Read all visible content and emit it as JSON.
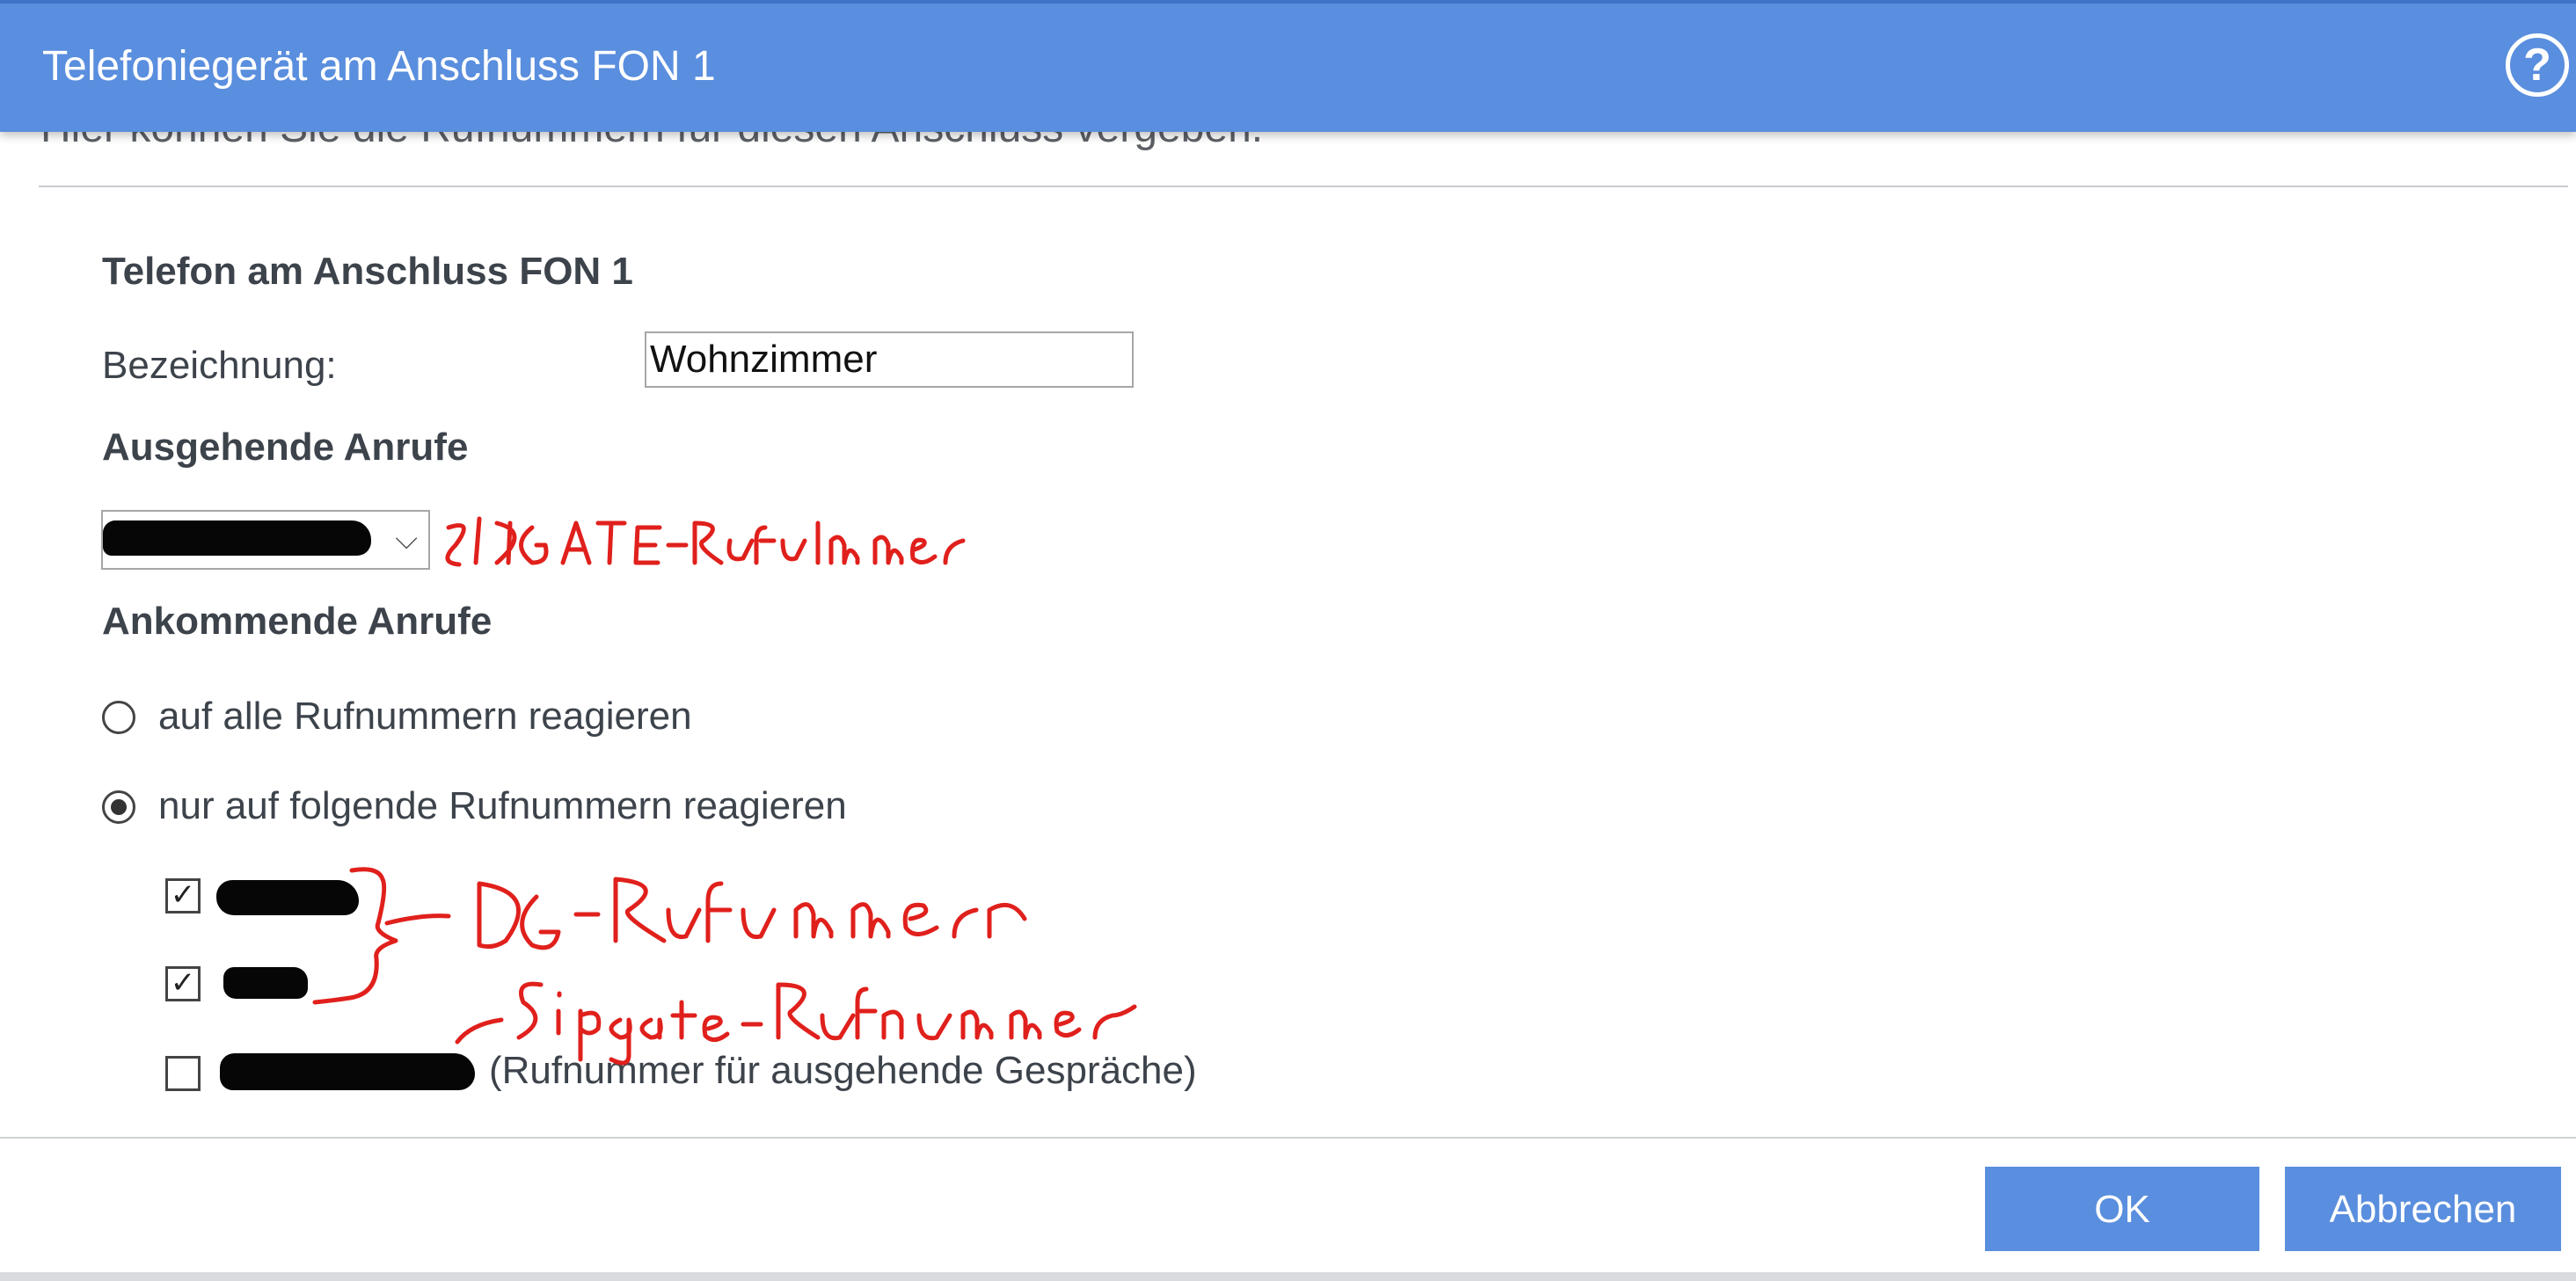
{
  "window": {
    "title": "Telefoniegerät am Anschluss FON 1",
    "help_symbol": "?"
  },
  "intro": {
    "partial_text": "Hier können Sie die Rufnummern für diesen Anschluss vergeben."
  },
  "section": {
    "title": "Telefon am Anschluss FON 1"
  },
  "name_field": {
    "label": "Bezeichnung:",
    "value": "Wohnzimmer"
  },
  "outgoing": {
    "heading": "Ausgehende Anrufe",
    "selected_value": "",
    "chevron": "⌵"
  },
  "incoming": {
    "heading": "Ankommende Anrufe",
    "options": [
      {
        "label": "auf alle Rufnummern reagieren",
        "selected": false
      },
      {
        "label": "nur auf folgende Rufnummern reagieren",
        "selected": true
      }
    ],
    "numbers": [
      {
        "checked": true,
        "suffix": ""
      },
      {
        "checked": true,
        "suffix": ""
      },
      {
        "checked": false,
        "suffix": "(Rufnummer für ausgehende Gespräche)"
      }
    ]
  },
  "annotations": {
    "color": "#e0201c",
    "notes": [
      "SIPGATE-Rufummer",
      "DG-Rufummern",
      "Sipgate-Rufnummer"
    ]
  },
  "buttons": {
    "ok": "OK",
    "cancel": "Abbrechen"
  },
  "icons": {
    "help": "help-icon",
    "select": "chevron-down-icon"
  }
}
